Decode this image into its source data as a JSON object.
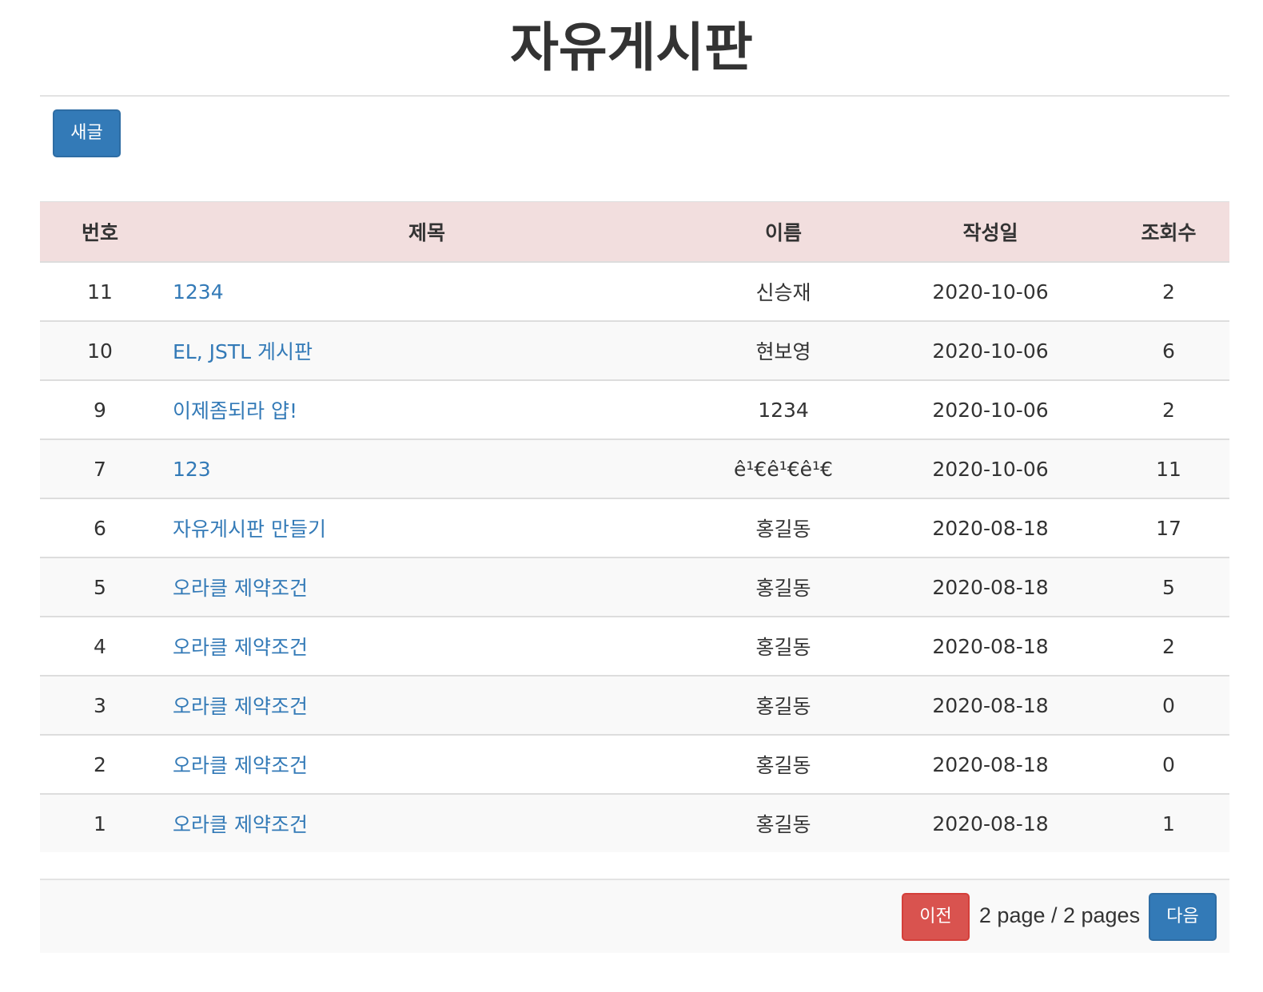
{
  "header": {
    "title": "자유게시판"
  },
  "toolbar": {
    "new_label": "새글"
  },
  "table": {
    "columns": [
      "번호",
      "제목",
      "이름",
      "작성일",
      "조회수"
    ],
    "rows": [
      {
        "no": "11",
        "subject": "1234",
        "name": "신승재",
        "date": "2020-10-06",
        "views": "2"
      },
      {
        "no": "10",
        "subject": "EL, JSTL 게시판",
        "name": "현보영",
        "date": "2020-10-06",
        "views": "6"
      },
      {
        "no": "9",
        "subject": "이제좀되라 얍!",
        "name": "1234",
        "date": "2020-10-06",
        "views": "2"
      },
      {
        "no": "7",
        "subject": "123",
        "name": "ê¹€ê¹€ê¹€",
        "date": "2020-10-06",
        "views": "11"
      },
      {
        "no": "6",
        "subject": "자유게시판 만들기",
        "name": "홍길동",
        "date": "2020-08-18",
        "views": "17"
      },
      {
        "no": "5",
        "subject": "오라클 제약조건",
        "name": "홍길동",
        "date": "2020-08-18",
        "views": "5"
      },
      {
        "no": "4",
        "subject": "오라클 제약조건",
        "name": "홍길동",
        "date": "2020-08-18",
        "views": "2"
      },
      {
        "no": "3",
        "subject": "오라클 제약조건",
        "name": "홍길동",
        "date": "2020-08-18",
        "views": "0"
      },
      {
        "no": "2",
        "subject": "오라클 제약조건",
        "name": "홍길동",
        "date": "2020-08-18",
        "views": "0"
      },
      {
        "no": "1",
        "subject": "오라클 제약조건",
        "name": "홍길동",
        "date": "2020-08-18",
        "views": "1"
      }
    ]
  },
  "pagination": {
    "prev_label": "이전",
    "info": "2 page / 2 pages",
    "next_label": "다음"
  },
  "colors": {
    "primary": "#337ab7",
    "danger": "#d9534f",
    "header_bg": "#f2dede",
    "stripe_bg": "#f9f9f9",
    "link": "#337ab7"
  }
}
